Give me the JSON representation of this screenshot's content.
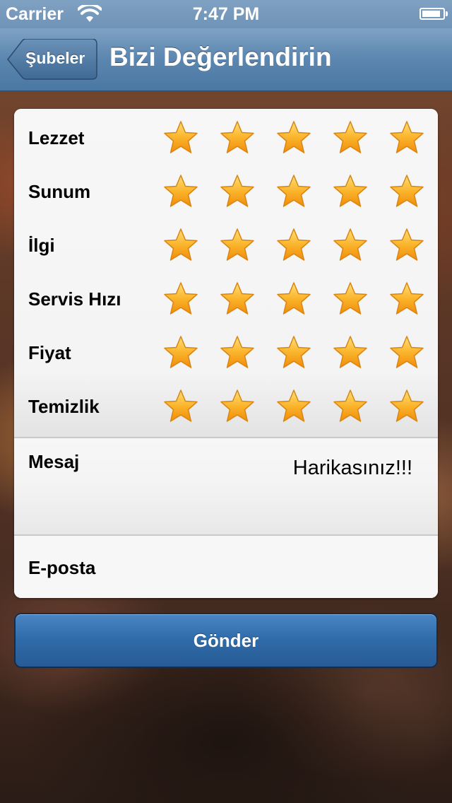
{
  "status_bar": {
    "carrier": "Carrier",
    "time": "7:47 PM",
    "battery_level": 0.9
  },
  "nav": {
    "back_label": "Şubeler",
    "title": "Bizi Değerlendirin"
  },
  "ratings": [
    {
      "label": "Lezzet",
      "stars": 5
    },
    {
      "label": "Sunum",
      "stars": 5
    },
    {
      "label": "İlgi",
      "stars": 5
    },
    {
      "label": "Servis Hızı",
      "stars": 5
    },
    {
      "label": "Fiyat",
      "stars": 5
    },
    {
      "label": "Temizlik",
      "stars": 5
    }
  ],
  "message": {
    "label": "Mesaj",
    "value": "Harikasınız!!!"
  },
  "email": {
    "label": "E-posta",
    "value": ""
  },
  "send_button": {
    "label": "Gönder"
  },
  "colors": {
    "nav": "#5b86af",
    "star": "#f6a21a",
    "button": "#2f6aa8"
  }
}
